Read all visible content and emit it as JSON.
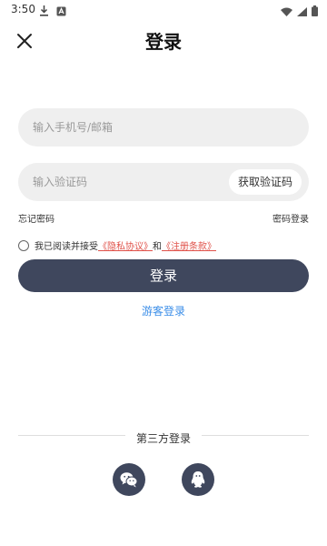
{
  "status_bar": {
    "time": "3:50",
    "left_icons": [
      "download-icon",
      "notification-icon"
    ],
    "right_icons": [
      "wifi-icon",
      "cellular-icon",
      "battery-icon"
    ]
  },
  "header": {
    "title": "登录",
    "close_icon": "close-icon"
  },
  "form": {
    "account_placeholder": "输入手机号/邮箱",
    "account_value": "",
    "code_placeholder": "输入验证码",
    "code_value": "",
    "get_code_label": "获取验证码"
  },
  "links": {
    "forgot_password": "忘记密码",
    "password_login": "密码登录"
  },
  "agreement": {
    "prefix": "我已阅读并接受",
    "privacy": "《隐私协议》",
    "and": "和",
    "terms": "《注册条款》",
    "checked": false
  },
  "login_label": "登录",
  "guest_login_label": "游客登录",
  "third_party": {
    "title": "第三方登录",
    "providers": [
      "wechat-icon",
      "qq-icon"
    ]
  },
  "colors": {
    "primary": "#3f475d",
    "link_blue": "#3b8ee8",
    "agreement_red": "#e0524a",
    "input_bg": "#efefef"
  }
}
